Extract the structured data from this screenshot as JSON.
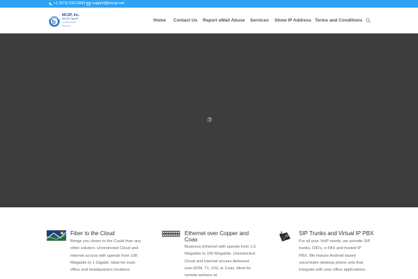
{
  "topbar": {
    "phone": "+1 (571) 633-0565",
    "email": "support@mcsp.net",
    "background": "#2ea3f2"
  },
  "logo": {
    "line1": "MCSP, Inc.",
    "line2": "Mid Tel Type B",
    "line3": "Certified Small Business"
  },
  "nav": {
    "items": [
      "Home",
      "Contact Us",
      "Report eMail Abuse",
      "Services",
      "Show IP Address",
      "Terms and Conditions"
    ],
    "search_icon": "search-icon"
  },
  "hero": {
    "background": "#3d3d3d",
    "loading_icon": "spinner-icon"
  },
  "features": [
    {
      "title": "Fiber to the Cloud",
      "text": "Brings you closer to the Could than any other solution. Unrestricted Cloud and Internet access with speeds from 100 Megabits to 1 Gigabit. Ideal for main office and headquarters locations.",
      "icon": "fiber-image-icon"
    },
    {
      "title": "Ethernet over Copper and Coax",
      "text": "Business Ethernet with speeds from 1.5 Megabits to 100 Megabits. Unrestricted Cloud and Internet access delivered over EFM, T1, DSL or Coax. Ideal for remote workers at",
      "icon": "network-switch-icon"
    },
    {
      "title": "SIP Trunks and Virtual IP PBX",
      "text": "For all your VoIP needs, we provide SIP trunks, DID's, e-FAX and hosted IP PBX. We feature Android based voice/video desktop phone sets that integrate with your office applications.",
      "icon": "desk-phone-icon"
    }
  ]
}
